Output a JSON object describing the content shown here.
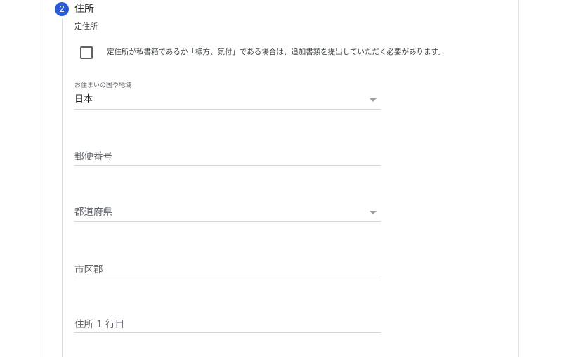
{
  "step": {
    "number": "2",
    "title": "住所"
  },
  "section": {
    "subtitle": "定住所"
  },
  "checkbox": {
    "checked": false,
    "label": "定住所が私書箱であるか「様方、気付」である場合は、追加書類を提出していただく必要があります。"
  },
  "fields": {
    "country": {
      "label": "お住まいの国や地域",
      "value": "日本",
      "icon": "dropdown-caret-icon"
    },
    "postal_code": {
      "placeholder": "郵便番号"
    },
    "prefecture": {
      "placeholder": "都道府県",
      "icon": "dropdown-caret-icon"
    },
    "city": {
      "placeholder": "市区郡"
    },
    "address_line1": {
      "placeholder": "住所 1 行目"
    }
  },
  "colors": {
    "accent": "#2a5bd7",
    "text": "#202124",
    "secondary_text": "#5f6368",
    "divider": "#d2d4d7"
  }
}
